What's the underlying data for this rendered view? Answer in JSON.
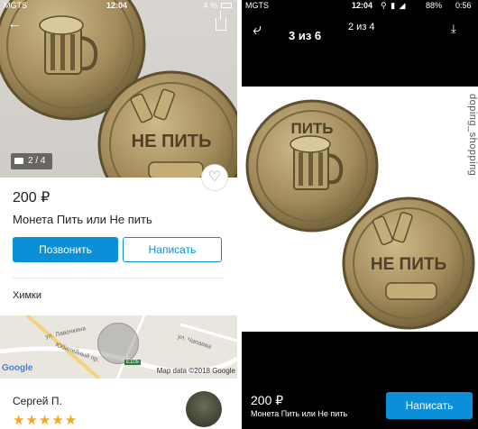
{
  "left": {
    "status": {
      "carrier": "MGTS",
      "time": "12:04",
      "battery": "4 %"
    },
    "photo_counter": "2 / 4",
    "coin_texts": {
      "front": "ПИТЬ",
      "back": "НЕ ПИТЬ"
    },
    "price": "200 ₽",
    "title": "Монета Пить или Не пить",
    "call_button": "Позвонить",
    "write_button": "Написать",
    "location": "Химки",
    "map": {
      "google": "Google",
      "map_data": "Map data ©2018 Google",
      "streets": [
        "ул. Лавочкина",
        "Юбилейный пр.",
        "ул. Чапаева"
      ],
      "road_badge": "E105"
    },
    "seller": {
      "name": "Сергей П.",
      "stars": "★★★★★"
    }
  },
  "right": {
    "status": {
      "carrier": "MGTS",
      "time": "12:04",
      "battery": "88%",
      "clock": "0:56"
    },
    "counter_main": "3 из 6",
    "counter_secondary": "2 из 4",
    "watermark": "doping_shopping",
    "coin_texts": {
      "front": "ПИТЬ",
      "back": "НЕ ПИТЬ"
    },
    "price": "200 ₽",
    "title": "Монета Пить или Не пить",
    "button": "Написать"
  },
  "colors": {
    "accent": "#0c8fd9",
    "star": "#f5a623",
    "coin": "#a89464"
  }
}
